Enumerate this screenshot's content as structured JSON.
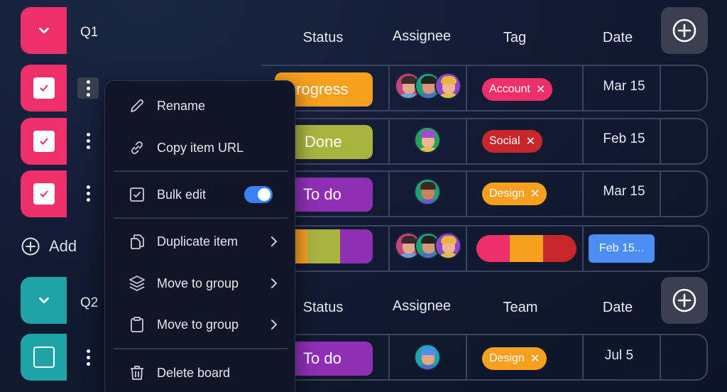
{
  "colors": {
    "pink": "#ee2f6a",
    "teal": "#1fa3a8",
    "orange": "#f7a020",
    "olive": "#a8b43e",
    "purple": "#8f2fb6",
    "red": "#c7262b",
    "blue": "#4a8ef6",
    "accent_toggle": "#3b82f6"
  },
  "groups": [
    {
      "name": "Q1",
      "columns": {
        "status": "Status",
        "assignee": "Assignee",
        "third": "Tag",
        "date": "Date"
      },
      "rows": [
        {
          "status": "In progress",
          "status_visible": "progress",
          "assignees": 3,
          "tag": "Account",
          "date": "Mar 15",
          "checked": true
        },
        {
          "status": "Done",
          "assignees": 1,
          "tag": "Social",
          "date": "Feb 15",
          "checked": true
        },
        {
          "status": "To do",
          "assignees": 1,
          "tag": "Design",
          "date": "Mar 15",
          "checked": true
        }
      ],
      "summary": {
        "date": "Feb 15..."
      }
    },
    {
      "name": "Q2",
      "columns": {
        "status": "Status",
        "assignee": "Assignee",
        "third": "Team",
        "date": "Date"
      },
      "rows": [
        {
          "status": "To do",
          "assignees": 1,
          "tag": "Design",
          "date": "Jul 5",
          "checked": false
        }
      ]
    }
  ],
  "add_label": "Add",
  "menu": {
    "items": [
      {
        "label": "Rename",
        "icon": "pencil-icon"
      },
      {
        "label": "Copy item URL",
        "icon": "link-icon"
      },
      {
        "label": "Bulk edit",
        "icon": "checkbox-icon",
        "toggle": true
      },
      {
        "label": "Duplicate item",
        "icon": "duplicate-icon",
        "submenu": true
      },
      {
        "label": "Move to group",
        "icon": "layers-icon",
        "submenu": true
      },
      {
        "label": "Move to group",
        "icon": "clipboard-icon",
        "submenu": true
      },
      {
        "label": "Delete board",
        "icon": "trash-icon"
      }
    ]
  }
}
